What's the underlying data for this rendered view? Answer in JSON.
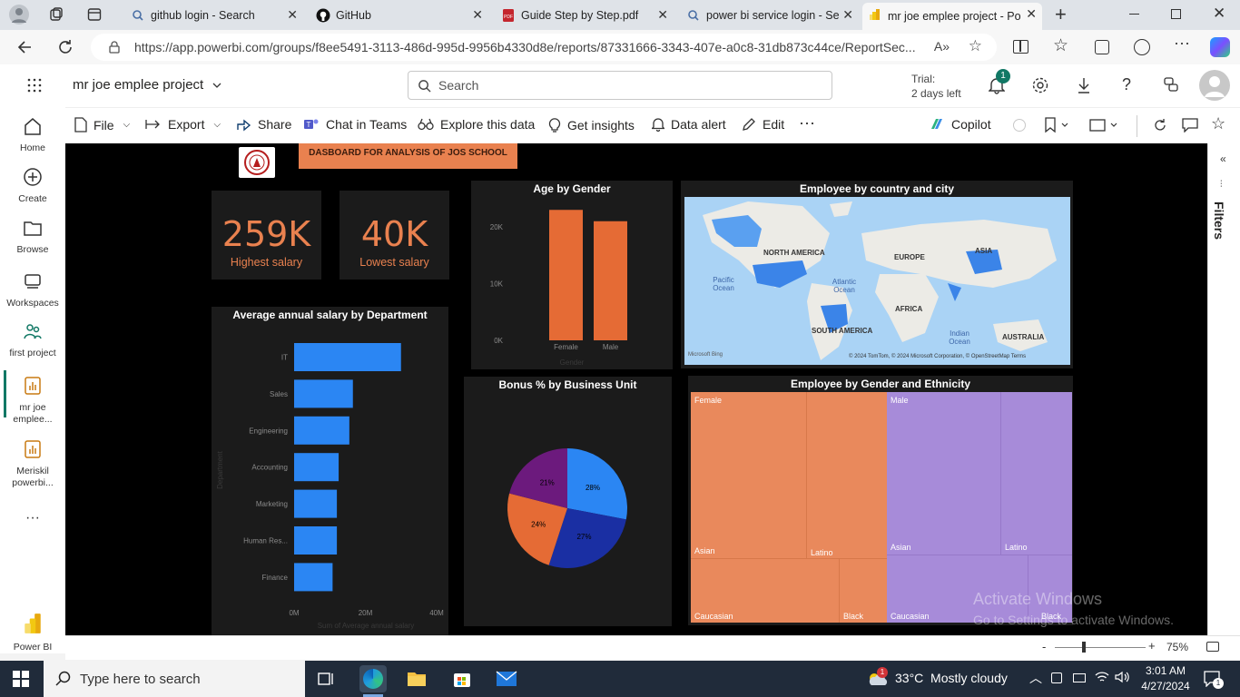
{
  "browser": {
    "tabs": [
      {
        "label": "github login - Search",
        "close": "✕"
      },
      {
        "label": "GitHub",
        "close": "✕"
      },
      {
        "label": "Guide Step by Step.pdf",
        "close": "✕"
      },
      {
        "label": "power bi service login - Se",
        "close": "✕"
      },
      {
        "label": "mr joe emplee project - Po",
        "close": "✕"
      }
    ],
    "new_tab": "+",
    "url": "https://app.powerbi.com/groups/f8ee5491-3113-486d-995d-9956b4330d8e/reports/87331666-3343-407e-a0c8-31db873c44ce/ReportSec..."
  },
  "powerbi": {
    "workspace_title": "mr joe emplee project",
    "search_placeholder": "Search",
    "trial_line1": "Trial:",
    "trial_line2": "2 days left",
    "notification_count": "1"
  },
  "leftnav": [
    {
      "label": "Home"
    },
    {
      "label": "Create"
    },
    {
      "label": "Browse"
    },
    {
      "label": "Workspaces"
    },
    {
      "label": "first project"
    },
    {
      "label": "mr joe emplee..."
    },
    {
      "label": "Meriskil powerbi..."
    },
    {
      "label": "Power BI"
    }
  ],
  "toolbar": {
    "file": "File",
    "export": "Export",
    "share": "Share",
    "chat": "Chat in Teams",
    "explore": "Explore this data",
    "insights": "Get insights",
    "alert": "Data alert",
    "edit": "Edit",
    "more": "···",
    "copilot": "Copilot"
  },
  "filters_label": "Filters",
  "report": {
    "title": "DASBOARD FOR ANALYSIS OF JOS SCHOOL",
    "card1": {
      "value": "259K",
      "label": "Highest salary"
    },
    "card2": {
      "value": "40K",
      "label": "Lowest salary"
    },
    "age_title": "Age by Gender",
    "map_title": "Employee by country and city",
    "dept_title": "Average annual salary by Department",
    "bonus_title": "Bonus % by Business Unit",
    "ethnic_title": "Employee by Gender and Ethnicity",
    "map_labels": {
      "na": "NORTH AMERICA",
      "eu": "EUROPE",
      "asia": "ASIA",
      "af": "AFRICA",
      "sa": "SOUTH AMERICA",
      "au": "AUSTRALIA",
      "pac": "Pacific Ocean",
      "atl": "Atlantic Ocean",
      "ind": "Indian Ocean",
      "credit": "© 2024 TomTom, © 2024 Microsoft Corporation, © OpenStreetMap  Terms",
      "bing": "Microsoft Bing"
    },
    "treemap": {
      "female": "Female",
      "male": "Male",
      "f_asian": "Asian",
      "f_latino": "Latino",
      "f_cauc": "Caucasian",
      "f_black": "Black",
      "m_asian": "Asian",
      "m_latino": "Latino",
      "m_cauc": "Caucasian",
      "m_black": "Black"
    }
  },
  "chart_data": [
    {
      "type": "bar",
      "title": "Age by Gender",
      "categories": [
        "Female",
        "Male"
      ],
      "values": [
        23000,
        21000
      ],
      "xlabel": "Gender",
      "ylabel": "",
      "ylim": [
        0,
        24000
      ],
      "yticks": [
        "20K",
        "10K",
        "0K"
      ],
      "color": "#e56b35"
    },
    {
      "type": "bar",
      "orientation": "horizontal",
      "title": "Average annual salary by Department",
      "categories": [
        "IT",
        "Sales",
        "Engineering",
        "Accounting",
        "Marketing",
        "Human Res...",
        "Finance"
      ],
      "values": [
        30000000,
        16500000,
        15500000,
        12500000,
        12000000,
        12000000,
        10800000
      ],
      "xlabel": "Sum of Average annual salary",
      "ylabel": "Department",
      "xlim": [
        0,
        40000000
      ],
      "xticks": [
        "0M",
        "20M",
        "40M"
      ],
      "color": "#2b86f3"
    },
    {
      "type": "pie",
      "title": "Bonus % by Business Unit",
      "labels": [
        "28%",
        "27%",
        "24%",
        "21%"
      ],
      "values": [
        28,
        27,
        24,
        21
      ],
      "colors": [
        "#2b86f3",
        "#1a2fa3",
        "#e56b35",
        "#6c1a7d"
      ]
    },
    {
      "type": "treemap",
      "title": "Employee by Gender and Ethnicity",
      "groups": [
        "Female",
        "Male"
      ],
      "categories": [
        "Asian",
        "Latino",
        "Caucasian",
        "Black"
      ]
    }
  ],
  "status": {
    "zoom": "75%",
    "minus": "-",
    "plus": "+"
  },
  "watermark": {
    "line1": "Activate Windows",
    "line2": "Go to Settings to activate Windows."
  },
  "taskbar": {
    "search": "Type here to search",
    "weather": "33°C  Mostly cloudy",
    "time": "3:01 AM",
    "date": "4/27/2024",
    "notif": "1",
    "weather_badge": "1"
  }
}
